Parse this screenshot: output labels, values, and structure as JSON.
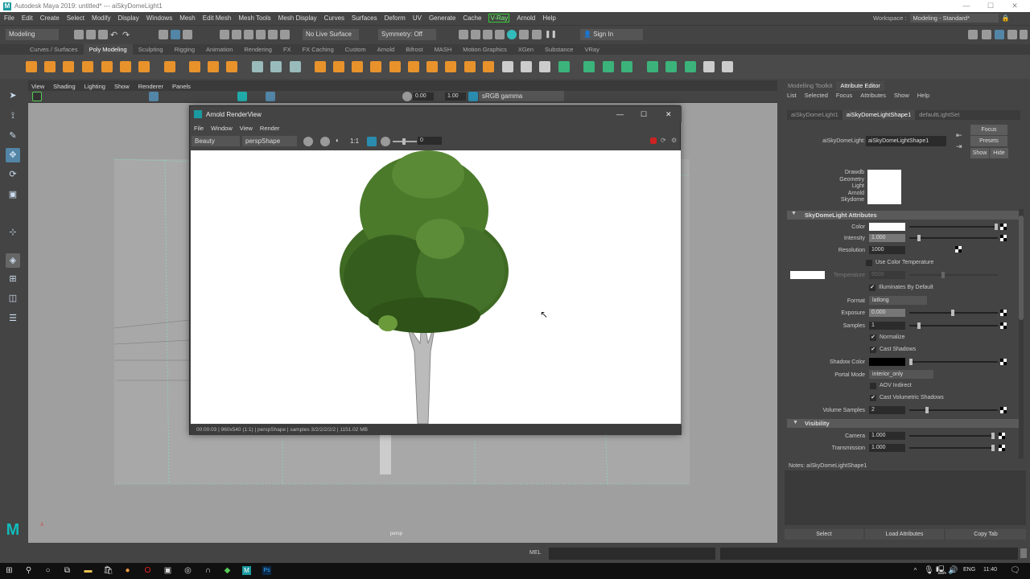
{
  "window": {
    "title": "Autodesk Maya 2019: untitled*   ---   aiSkyDomeLight1",
    "logo": "M",
    "min": "—",
    "max": "☐",
    "close": "✕"
  },
  "menubar": [
    "File",
    "Edit",
    "Create",
    "Select",
    "Modify",
    "Display",
    "Windows",
    "Mesh",
    "Edit Mesh",
    "Mesh Tools",
    "Mesh Display",
    "Curves",
    "Surfaces",
    "Deform",
    "UV",
    "Generate",
    "Cache",
    "V-Ray",
    "Arnold",
    "Help"
  ],
  "workspace": {
    "label": "Workspace :",
    "value": "Modeling - Standard*"
  },
  "statusline": {
    "mode": "Modeling",
    "live_surface": "No Live Surface",
    "symmetry": "Symmetry: Off",
    "sign_in": "Sign In"
  },
  "shelf_tabs": [
    "Curves / Surfaces",
    "Poly Modeling",
    "Sculpting",
    "Rigging",
    "Animation",
    "Rendering",
    "FX",
    "FX Caching",
    "Custom",
    "Arnold",
    "Bifrost",
    "MASH",
    "Motion Graphics",
    "XGen",
    "Substance",
    "VRay"
  ],
  "shelf_active": "Poly Modeling",
  "viewport": {
    "menu": [
      "View",
      "Shading",
      "Lighting",
      "Show",
      "Renderer",
      "Panels"
    ],
    "exposure": "0.00",
    "gamma": "1.00",
    "colorspace": "sRGB gamma",
    "camera_label": "persp"
  },
  "renderview": {
    "title": "Arnold RenderView",
    "menu": [
      "File",
      "Window",
      "View",
      "Render"
    ],
    "aov": "Beauty",
    "camera": "perspShape",
    "ratio": "1:1",
    "slider_value": "0",
    "status": "00:00:03 | 960x540 (1:1) | perspShape  | samples 3/2/2/2/2/2 | 1151.02 MB"
  },
  "attribute_editor": {
    "panel_tabs": [
      "Modelling Toolkit",
      "Attribute Editor"
    ],
    "menu": [
      "List",
      "Selected",
      "Focus",
      "Attributes",
      "Show",
      "Help"
    ],
    "node_tabs": [
      "aiSkyDomeLight1",
      "aiSkyDomeLightShape1",
      "defaultLightSet"
    ],
    "node_type": "aiSkyDomeLight:",
    "node_name": "aiSkyDomeLightShape1",
    "buttons": {
      "focus": "Focus",
      "presets": "Presets",
      "show": "Show",
      "hide": "Hide"
    },
    "swatch_labels": [
      "Drawdb",
      "Geometry",
      "Light",
      "Arnold",
      "Skydome"
    ],
    "section1": "SkyDomeLight Attributes",
    "color_label": "Color",
    "intensity": {
      "label": "Intensity",
      "value": "1.000"
    },
    "resolution": {
      "label": "Resolution",
      "value": "1000"
    },
    "use_color_temp": "Use Color Temperature",
    "temperature": {
      "label": "Temperature",
      "value": "6500"
    },
    "illuminates": "Illuminates By Default",
    "format": {
      "label": "Format",
      "value": "latlong"
    },
    "exposure": {
      "label": "Exposure",
      "value": "0.000"
    },
    "samples": {
      "label": "Samples",
      "value": "1"
    },
    "normalize": "Normalize",
    "cast_shadows": "Cast Shadows",
    "shadow_color": "Shadow Color",
    "portal_mode": {
      "label": "Portal Mode",
      "value": "interior_only"
    },
    "aov_indirect": "AOV Indirect",
    "cast_vol": "Cast Volumetric Shadows",
    "volume_samples": {
      "label": "Volume Samples",
      "value": "2"
    },
    "section2": "Visibility",
    "camera": {
      "label": "Camera",
      "value": "1.000"
    },
    "transmission": {
      "label": "Transmission",
      "value": "1.000"
    },
    "notes": "Notes:  aiSkyDomeLightShape1",
    "bottom": [
      "Select",
      "Load Attributes",
      "Copy Tab"
    ]
  },
  "cmdline": {
    "label": "MEL"
  },
  "taskbar": {
    "lang": "ENG",
    "time": "11:40"
  }
}
